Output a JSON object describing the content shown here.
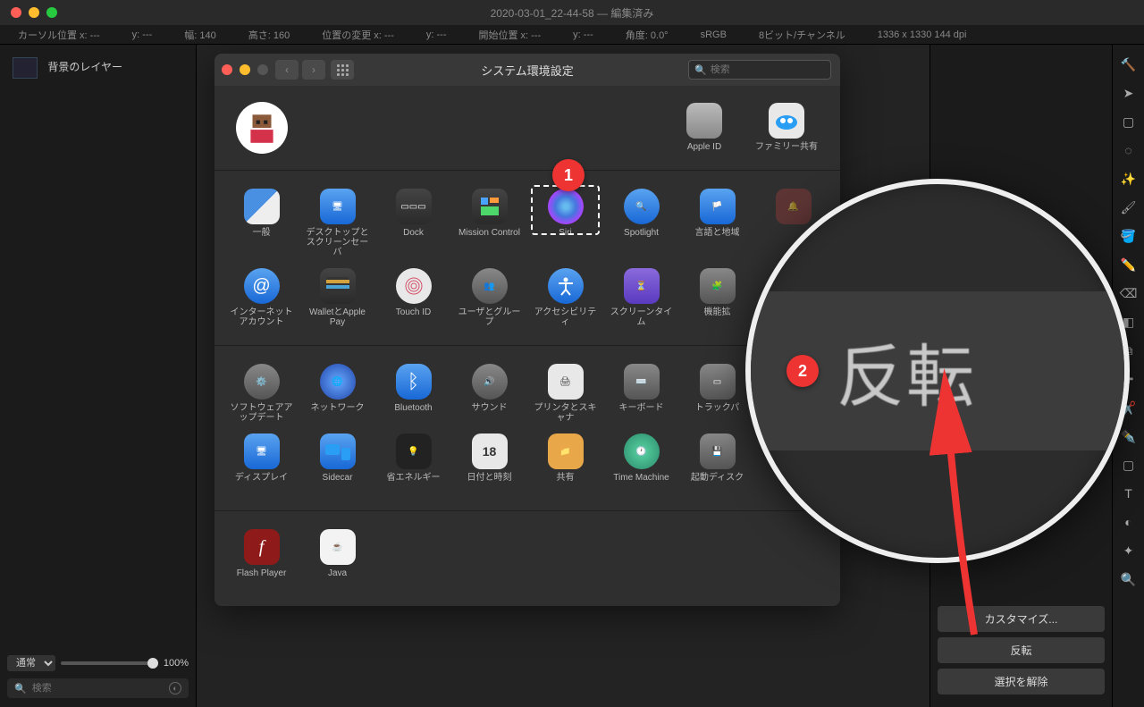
{
  "editor": {
    "title": "2020-03-01_22-44-58 — 編集済み",
    "info": {
      "cursor_x": "カーソル位置 x: ---",
      "cursor_y": "y: ---",
      "width": "幅: 140",
      "height": "高さ: 160",
      "dx": "位置の変更 x: ---",
      "dy": "y: ---",
      "start_x": "開始位置 x: ---",
      "start_y": "y: ---",
      "angle": "角度: 0.0°",
      "color": "sRGB",
      "depth": "8ビット/チャンネル",
      "dims": "1336 x 1330 144 dpi"
    },
    "layer": "背景のレイヤー",
    "blend_mode": "通常",
    "opacity": "100%",
    "search_placeholder": "検索"
  },
  "syspref": {
    "title": "システム環境設定",
    "search_placeholder": "検索",
    "apple_id": "Apple ID",
    "family": "ファミリー共有",
    "row1": [
      "一般",
      "デスクトップとスクリーンセーバ",
      "Dock",
      "Mission Control",
      "Siri",
      "Spotlight",
      "言語と地域",
      ""
    ],
    "row2": [
      "インターネットアカウント",
      "WalletとApple Pay",
      "Touch ID",
      "ユーザとグループ",
      "アクセシビリティ",
      "スクリーンタイム",
      "機能拡",
      ""
    ],
    "row3": [
      "ソフトウェアアップデート",
      "ネットワーク",
      "Bluetooth",
      "サウンド",
      "プリンタとスキャナ",
      "キーボード",
      "トラックパ",
      ""
    ],
    "row4": [
      "ディスプレイ",
      "Sidecar",
      "省エネルギー",
      "日付と時刻",
      "共有",
      "Time Machine",
      "起動ディスク",
      ""
    ],
    "row5": [
      "Flash Player",
      "Java"
    ]
  },
  "right_panel": {
    "customize": "カスタマイズ...",
    "flip": "反転",
    "deselect": "選択を解除"
  },
  "annotations": {
    "marker1": "1",
    "marker2": "2",
    "magnified_text": "反転"
  }
}
